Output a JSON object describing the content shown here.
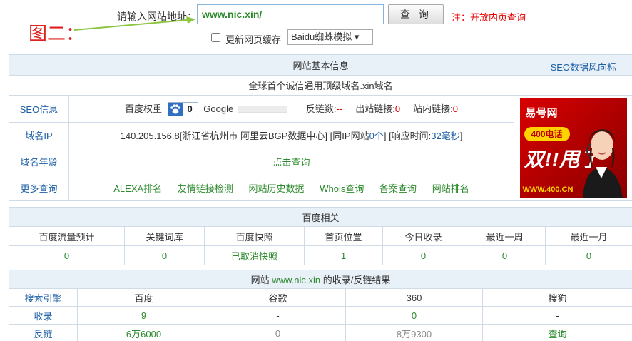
{
  "search": {
    "label": "请输入网站地址：",
    "url_value": "www.nic.xin/",
    "button_label": "查 询",
    "note": "注：开放内页查询",
    "cache_label": "更新网页缓存",
    "select_value": "Baidu蜘蛛模拟 ▾"
  },
  "annotation": {
    "label": "图二："
  },
  "basic": {
    "title": "网站基本信息",
    "trend_link": "SEO数据风向标",
    "description": "全球首个诚信通用顶级域名.xin域名",
    "seo": {
      "label": "SEO信息",
      "baidu_weight_label": "百度权重",
      "baidu_weight_value": "0",
      "google_label": "Google",
      "backlinks_label": "反链数:",
      "backlinks_value": "--",
      "outbound_label": "出站链接:",
      "outbound_value": "0",
      "internal_label": "站内链接:",
      "internal_value": "0"
    },
    "ip": {
      "label": "域名IP",
      "ip_text": "140.205.156.8[浙江省杭州市 阿里云BGP数据中心]",
      "same_ip_prefix": "[同IP网站",
      "same_ip_count": "0个",
      "same_ip_suffix": "]",
      "resp_prefix": "[响应时间:",
      "resp_value": "32毫秒",
      "resp_suffix": "]"
    },
    "age": {
      "label": "域名年龄",
      "link": "点击查询"
    },
    "more": {
      "label": "更多查询",
      "links": [
        "ALEXA排名",
        "友情链接检测",
        "网站历史数据",
        "Whois查询",
        "备案查询",
        "网站排名"
      ]
    },
    "ad": {
      "brand": "易号网",
      "phone": "400电话",
      "slogan": "双!!甩了",
      "url": "WWW.400.CN"
    }
  },
  "baidu": {
    "title": "百度相关",
    "headers": [
      "百度流量预计",
      "关键词库",
      "百度快照",
      "首页位置",
      "今日收录",
      "最近一周",
      "最近一月"
    ],
    "values": [
      "0",
      "0",
      "已取消快照",
      "1",
      "0",
      "0",
      "0"
    ]
  },
  "index": {
    "title_prefix": "网站",
    "title_domain": "www.nic.xin",
    "title_suffix": "的收录/反链结果",
    "headers": [
      "搜索引擎",
      "百度",
      "谷歌",
      "360",
      "搜狗"
    ],
    "included": {
      "label": "收录",
      "values": [
        "9",
        "-",
        "0",
        "-"
      ]
    },
    "backlinks": {
      "label": "反链",
      "values": [
        "6万6000",
        "0",
        "8万9300",
        "查询"
      ]
    }
  },
  "colors": {
    "accent_blue": "#1d5fa4",
    "link_green": "#2c8a2c",
    "alert_red": "#e60000",
    "header_bg": "#e8f0f8",
    "border": "#cfdbe6"
  }
}
